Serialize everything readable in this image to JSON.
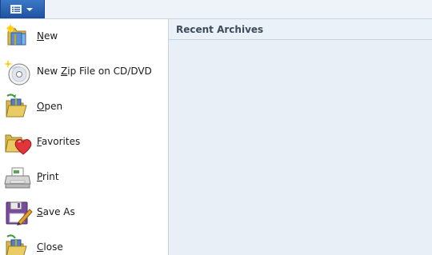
{
  "menu": {
    "items": [
      {
        "pre": "",
        "key": "N",
        "post": "ew",
        "icon": "new-archive-icon"
      },
      {
        "pre": "New ",
        "key": "Z",
        "post": "ip File on CD/DVD",
        "icon": "cd-dvd-icon"
      },
      {
        "pre": "",
        "key": "O",
        "post": "pen",
        "icon": "open-folder-icon"
      },
      {
        "pre": "",
        "key": "F",
        "post": "avorites",
        "icon": "favorites-heart-icon"
      },
      {
        "pre": "",
        "key": "P",
        "post": "rint",
        "icon": "printer-icon"
      },
      {
        "pre": "",
        "key": "S",
        "post": "ave As",
        "icon": "save-as-icon"
      },
      {
        "pre": "",
        "key": "C",
        "post": "lose",
        "icon": "close-folder-icon"
      }
    ]
  },
  "recent": {
    "title": "Recent Archives"
  },
  "colors": {
    "accent": "#2a5fae",
    "pane_background": "#e8eff7"
  }
}
